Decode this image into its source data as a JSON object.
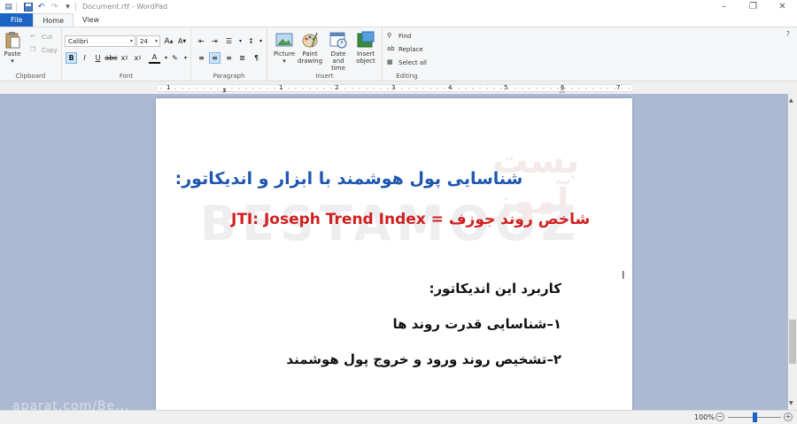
{
  "window": {
    "title": "Document.rtf - WordPad"
  },
  "tabs": [
    {
      "label": "File"
    },
    {
      "label": "Home"
    },
    {
      "label": "View"
    }
  ],
  "ribbon": {
    "clipboard": {
      "label": "Clipboard",
      "paste": "Paste",
      "cut": "Cut",
      "copy": "Copy"
    },
    "font": {
      "label": "Font",
      "family": "Calibri",
      "size": "24"
    },
    "paragraph": {
      "label": "Paragraph"
    },
    "insert": {
      "label": "Insert",
      "picture": "Picture",
      "paint_line1": "Paint",
      "paint_line2": "drawing",
      "date_line1": "Date and",
      "date_line2": "time",
      "object_line1": "Insert",
      "object_line2": "object"
    },
    "editing": {
      "label": "Editing",
      "find": "Find",
      "replace": "Replace",
      "select_all": "Select all"
    }
  },
  "ruler": {
    "numbers": [
      "1",
      "1",
      "2",
      "3",
      "4",
      "5",
      "6",
      "7"
    ]
  },
  "document": {
    "heading": "شناسایی پول هوشمند با ابزار و اندیکاتور:",
    "subheading": "JTI: Joseph Trend Index = شاخص روند جوزف",
    "line1": "کاربرد این اندیکاتور:",
    "line2": "۱–شناسایی قدرت روند ها",
    "line3": "۲–تشخیص روند ورود و خروج پول هوشمند",
    "watermark": "BESTAMOOZ",
    "watermark_fa": "بست آموز"
  },
  "status": {
    "zoom": "100%"
  },
  "overlay": {
    "text": "aparat.com/Be..."
  },
  "colors": {
    "file_tab": "#1c64c4",
    "heading": "#1e56b0",
    "subheading": "#d02020",
    "workspace": "#abb9d3"
  }
}
